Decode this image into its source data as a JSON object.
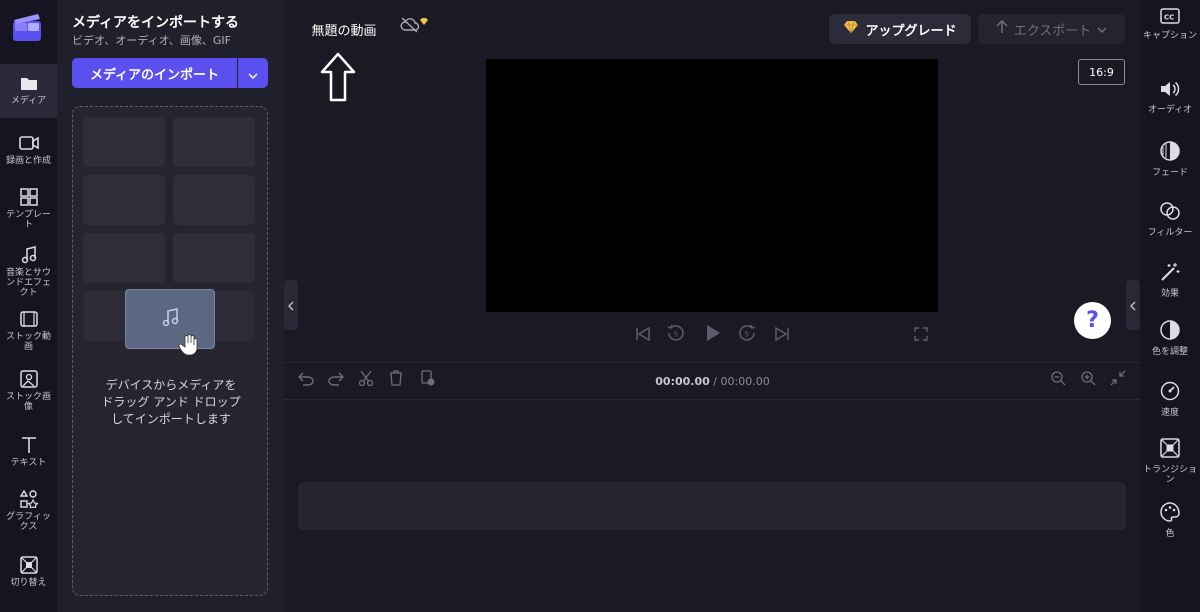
{
  "colors": {
    "accent": "#5b4ff0",
    "gem": "#f5c04a",
    "canvas": "#000000"
  },
  "left_rail": {
    "items": [
      {
        "label": "メディア",
        "icon": "folder-icon"
      },
      {
        "label": "録画と作成",
        "icon": "video-camera-icon"
      },
      {
        "label": "テンプレート",
        "icon": "templates-icon"
      },
      {
        "label": "音楽とサウンドエフェクト",
        "icon": "music-note-icon"
      },
      {
        "label": "ストック動画",
        "icon": "film-icon"
      },
      {
        "label": "ストック画像",
        "icon": "image-icon"
      },
      {
        "label": "テキスト",
        "icon": "text-icon"
      },
      {
        "label": "グラフィックス",
        "icon": "shapes-icon"
      },
      {
        "label": "切り替え",
        "icon": "transition-icon"
      }
    ]
  },
  "media_panel": {
    "title": "メディアをインポートする",
    "subtitle": "ビデオ、オーディオ、画像、GIF",
    "import_button": "メディアのインポート",
    "drop_text": "デバイスからメディアを\nドラッグ アンド ドロップ\nしてインポートします"
  },
  "top_bar": {
    "project_title": "無題の動画",
    "upgrade_label": "アップグレード",
    "export_label": "エクスポート",
    "aspect_ratio": "16:9"
  },
  "timeline": {
    "current_time": "00:00.00",
    "separator": " / ",
    "total_time": "00:00.00"
  },
  "help": {
    "label": "?"
  },
  "right_rail": {
    "items": [
      {
        "label": "キャプション",
        "icon": "captions-icon"
      },
      {
        "label": "オーディオ",
        "icon": "speaker-icon"
      },
      {
        "label": "フェード",
        "icon": "fade-icon"
      },
      {
        "label": "フィルター",
        "icon": "filter-icon"
      },
      {
        "label": "効果",
        "icon": "magic-wand-icon"
      },
      {
        "label": "色を調整",
        "icon": "contrast-icon"
      },
      {
        "label": "速度",
        "icon": "speedometer-icon"
      },
      {
        "label": "トランジション",
        "icon": "transition-icon"
      },
      {
        "label": "色",
        "icon": "palette-icon"
      }
    ]
  }
}
